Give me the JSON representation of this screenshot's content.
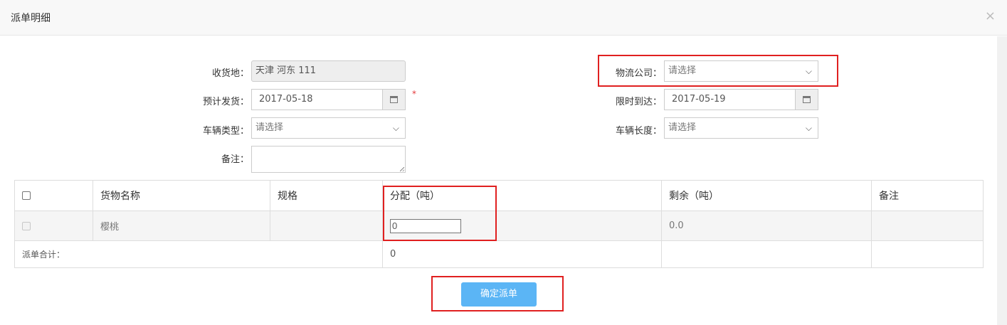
{
  "dialog": {
    "title": "派单明细",
    "close_glyph": "×"
  },
  "form": {
    "destination": {
      "label": "收货地：",
      "value": "天津 河东 111"
    },
    "logistics_company": {
      "label": "物流公司：",
      "value": "请选择"
    },
    "planned_ship": {
      "label": "预计发货：",
      "value": "2017-05-18",
      "required_mark": "*"
    },
    "deadline_arrival": {
      "label": "限时到达：",
      "value": "2017-05-19"
    },
    "vehicle_type": {
      "label": "车辆类型：",
      "value": "请选择"
    },
    "vehicle_length": {
      "label": "车辆长度：",
      "value": "请选择"
    },
    "remark": {
      "label": "备注：",
      "value": ""
    }
  },
  "table": {
    "headers": [
      "货物名称",
      "规格",
      "分配（吨）",
      "剩余（吨）",
      "备注"
    ],
    "rows": [
      {
        "name": "樱桃",
        "spec": "",
        "allocation": "0",
        "remaining": "0.0",
        "remark": ""
      }
    ],
    "total": {
      "label": "派单合计：",
      "value": "0"
    }
  },
  "actions": {
    "confirm_label": "确定派单"
  },
  "colors": {
    "accent": "#5bb5f5",
    "highlight_box": "#e02020",
    "required": "#e4393c"
  }
}
